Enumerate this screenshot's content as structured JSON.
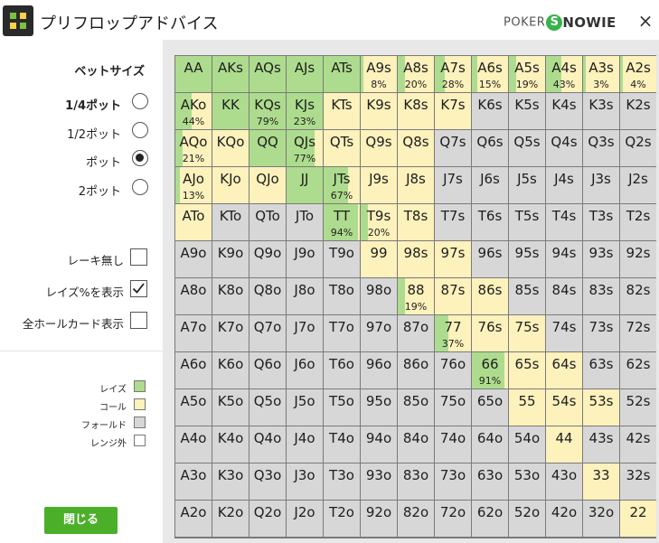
{
  "title": "プリフロップアドバイス",
  "brand": {
    "poker": "POKER",
    "s": "S",
    "rest": "NOWIE"
  },
  "close_icon": "×",
  "bet_size": {
    "heading": "ベットサイズ",
    "options": [
      {
        "label": "1/4ポット",
        "bold": true,
        "selected": false
      },
      {
        "label": "1/2ポット",
        "bold": false,
        "selected": false
      },
      {
        "label": "ポット",
        "bold": false,
        "selected": true
      },
      {
        "label": "2ポット",
        "bold": false,
        "selected": false
      }
    ]
  },
  "checks": [
    {
      "label": "レーキ無し",
      "checked": false
    },
    {
      "label": "レイズ%を表示",
      "checked": true
    },
    {
      "label": "全ホールカード表示",
      "checked": false
    }
  ],
  "legend": [
    {
      "label": "レイズ",
      "color": "#aedc8e"
    },
    {
      "label": "コール",
      "color": "#fdf1bc"
    },
    {
      "label": "フォールド",
      "color": "#d7d7d7"
    },
    {
      "label": "レンジ外",
      "color": "#ffffff"
    }
  ],
  "close_button": "閉じる",
  "colors": {
    "raise": "#aedc8e",
    "call": "#fdf1bc",
    "fold": "#d7d7d7"
  },
  "ranks": [
    "A",
    "K",
    "Q",
    "J",
    "T",
    "9",
    "8",
    "7",
    "6",
    "5",
    "4",
    "3",
    "2"
  ],
  "grid": [
    [
      "AA",
      "AKs",
      "AQs",
      "AJs",
      "ATs",
      "A9s",
      "A8s",
      "A7s",
      "A6s",
      "A5s",
      "A4s",
      "A3s",
      "A2s"
    ],
    [
      "AKo",
      "KK",
      "KQs",
      "KJs",
      "KTs",
      "K9s",
      "K8s",
      "K7s",
      "K6s",
      "K5s",
      "K4s",
      "K3s",
      "K2s"
    ],
    [
      "AQo",
      "KQo",
      "QQ",
      "QJs",
      "QTs",
      "Q9s",
      "Q8s",
      "Q7s",
      "Q6s",
      "Q5s",
      "Q4s",
      "Q3s",
      "Q2s"
    ],
    [
      "AJo",
      "KJo",
      "QJo",
      "JJ",
      "JTs",
      "J9s",
      "J8s",
      "J7s",
      "J6s",
      "J5s",
      "J4s",
      "J3s",
      "J2s"
    ],
    [
      "ATo",
      "KTo",
      "QTo",
      "JTo",
      "TT",
      "T9s",
      "T8s",
      "T7s",
      "T6s",
      "T5s",
      "T4s",
      "T3s",
      "T2s"
    ],
    [
      "A9o",
      "K9o",
      "Q9o",
      "J9o",
      "T9o",
      "99",
      "98s",
      "97s",
      "96s",
      "95s",
      "94s",
      "93s",
      "92s"
    ],
    [
      "A8o",
      "K8o",
      "Q8o",
      "J8o",
      "T8o",
      "98o",
      "88",
      "87s",
      "86s",
      "85s",
      "84s",
      "83s",
      "82s"
    ],
    [
      "A7o",
      "K7o",
      "Q7o",
      "J7o",
      "T7o",
      "97o",
      "87o",
      "77",
      "76s",
      "75s",
      "74s",
      "73s",
      "72s"
    ],
    [
      "A6o",
      "K6o",
      "Q6o",
      "J6o",
      "T6o",
      "96o",
      "86o",
      "76o",
      "66",
      "65s",
      "64s",
      "63s",
      "62s"
    ],
    [
      "A5o",
      "K5o",
      "Q5o",
      "J5o",
      "T5o",
      "95o",
      "85o",
      "75o",
      "65o",
      "55",
      "54s",
      "53s",
      "52s"
    ],
    [
      "A4o",
      "K4o",
      "Q4o",
      "J4o",
      "T4o",
      "94o",
      "84o",
      "74o",
      "64o",
      "54o",
      "44",
      "43s",
      "42s"
    ],
    [
      "A3o",
      "K3o",
      "Q3o",
      "J3o",
      "T3o",
      "93o",
      "83o",
      "73o",
      "63o",
      "53o",
      "43o",
      "33",
      "32s"
    ],
    [
      "A2o",
      "K2o",
      "Q2o",
      "J2o",
      "T2o",
      "92o",
      "82o",
      "72o",
      "62o",
      "52o",
      "42o",
      "32o",
      "22"
    ]
  ],
  "actions": [
    "RRRRRCCCCCCCC",
    "CRRRCCCCFFFFF",
    "CCRCCCCFFFFFF",
    "CCCRCCCFFFFFF",
    "CFFFCCCFFFFFF",
    "FFFFFCCCFFFFF",
    "FFFFFFCCCFFFF",
    "FFFFFFFCCCFFF",
    "FFFFFFFFCCCFF",
    "FFFFFFFFFCCCF",
    "FFFFFFFFFFCFF",
    "FFFFFFFFFFFCF",
    "FFFFFFFFFFFFC"
  ],
  "raise_pct": {
    "0,5": 8,
    "0,6": 20,
    "0,7": 28,
    "0,8": 15,
    "0,9": 19,
    "0,10": 43,
    "0,11": 3,
    "0,12": 4,
    "1,0": 44,
    "1,2": 79,
    "1,3": 23,
    "2,0": 21,
    "2,3": 77,
    "3,0": 13,
    "3,4": 67,
    "4,4": 94,
    "4,5": 20,
    "6,6": 19,
    "7,7": 37,
    "8,8": 91
  }
}
